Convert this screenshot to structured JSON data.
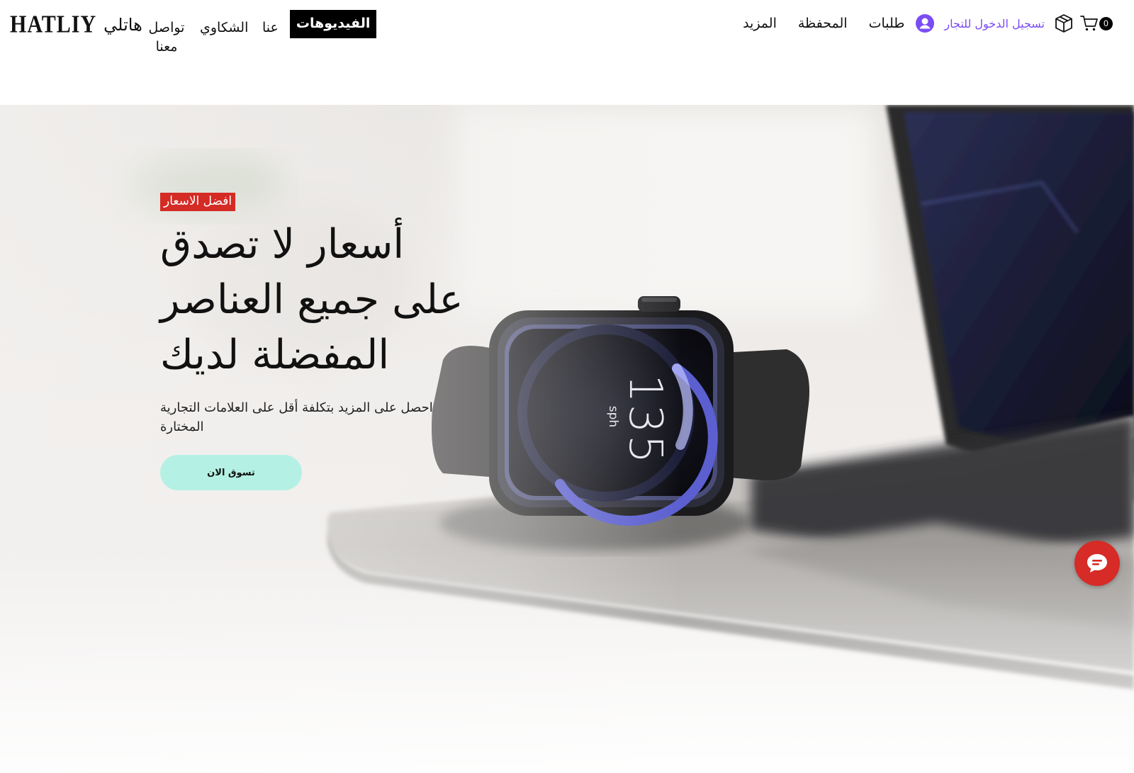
{
  "header": {
    "logo_latin": "HATLIY",
    "logo_arabic": "هاتلي",
    "nav_left": {
      "contact": "تواصل معنا",
      "complaints": "الشكاوي",
      "about": "عنا",
      "videos": "الفيديوهات"
    },
    "nav_right": {
      "more": "المزيد",
      "wallet": "المحفظة",
      "orders": "طلبات",
      "merchant_login": "تسجيل الدخول للتجار",
      "cart_count": "0"
    },
    "icons": [
      "user-avatar-icon",
      "package-box-icon",
      "shopping-cart-icon"
    ],
    "colors": {
      "merchant_link": "#7b4cf3",
      "videos_bg": "#000000"
    }
  },
  "hero": {
    "badge": "افضل الاسعار",
    "headline": [
      "أسعار لا تصدق",
      "على جميع العناصر",
      "المفضلة لديك"
    ],
    "subtext": [
      "احصل على المزيد بتكلفة أقل على العلامات التجارية",
      "المختارة"
    ],
    "cta": "تسوق الان",
    "watch_display": {
      "value": "135",
      "unit": "sph"
    },
    "colors": {
      "badge_bg": "#d42b25",
      "cta_bg": "#b4f1e4",
      "chat_bg": "#d62b26"
    }
  },
  "chat": {
    "icon": "chat-bubble-icon"
  }
}
